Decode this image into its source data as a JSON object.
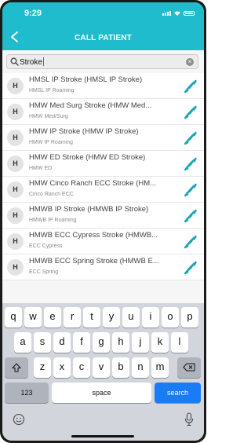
{
  "status": {
    "time": "9:29"
  },
  "header": {
    "title": "CALL PATIENT"
  },
  "search": {
    "value": "Stroke"
  },
  "contacts": [
    {
      "initial": "H",
      "name": "HMSL IP Stroke (HMSL IP Stroke)",
      "sub": "HMSL IP Roaming"
    },
    {
      "initial": "H",
      "name": "HMW Med Surg Stroke (HMW Med...",
      "sub": "HMW Med/Surg"
    },
    {
      "initial": "H",
      "name": "HMW IP Stroke (HMW IP Stroke)",
      "sub": "HMW IP Roaming"
    },
    {
      "initial": "H",
      "name": "HMW ED Stroke (HMW ED Stroke)",
      "sub": "HMW ED"
    },
    {
      "initial": "H",
      "name": "HMW Cinco Ranch ECC Stroke (HM...",
      "sub": "Cinco Ranch ECC"
    },
    {
      "initial": "H",
      "name": "HMWB IP Stroke (HMWB IP Stroke)",
      "sub": "HMWB IP Roaming"
    },
    {
      "initial": "H",
      "name": "HMWB ECC Cypress Stroke (HMWB...",
      "sub": "ECC Cypress"
    },
    {
      "initial": "H",
      "name": "HMWB ECC Spring Stroke (HMWB E...",
      "sub": "ECC Spring"
    }
  ],
  "keyboard": {
    "row1": [
      "q",
      "w",
      "e",
      "r",
      "t",
      "y",
      "u",
      "i",
      "o",
      "p"
    ],
    "row2": [
      "a",
      "s",
      "d",
      "f",
      "g",
      "h",
      "j",
      "k",
      "l"
    ],
    "row3": [
      "z",
      "x",
      "c",
      "v",
      "b",
      "n",
      "m"
    ],
    "numbers_label": "123",
    "space_label": "space",
    "search_label": "search"
  },
  "colors": {
    "header": "#1ebccc",
    "phone_icon": "#1ea6b8",
    "search_key": "#1a7cf5"
  }
}
